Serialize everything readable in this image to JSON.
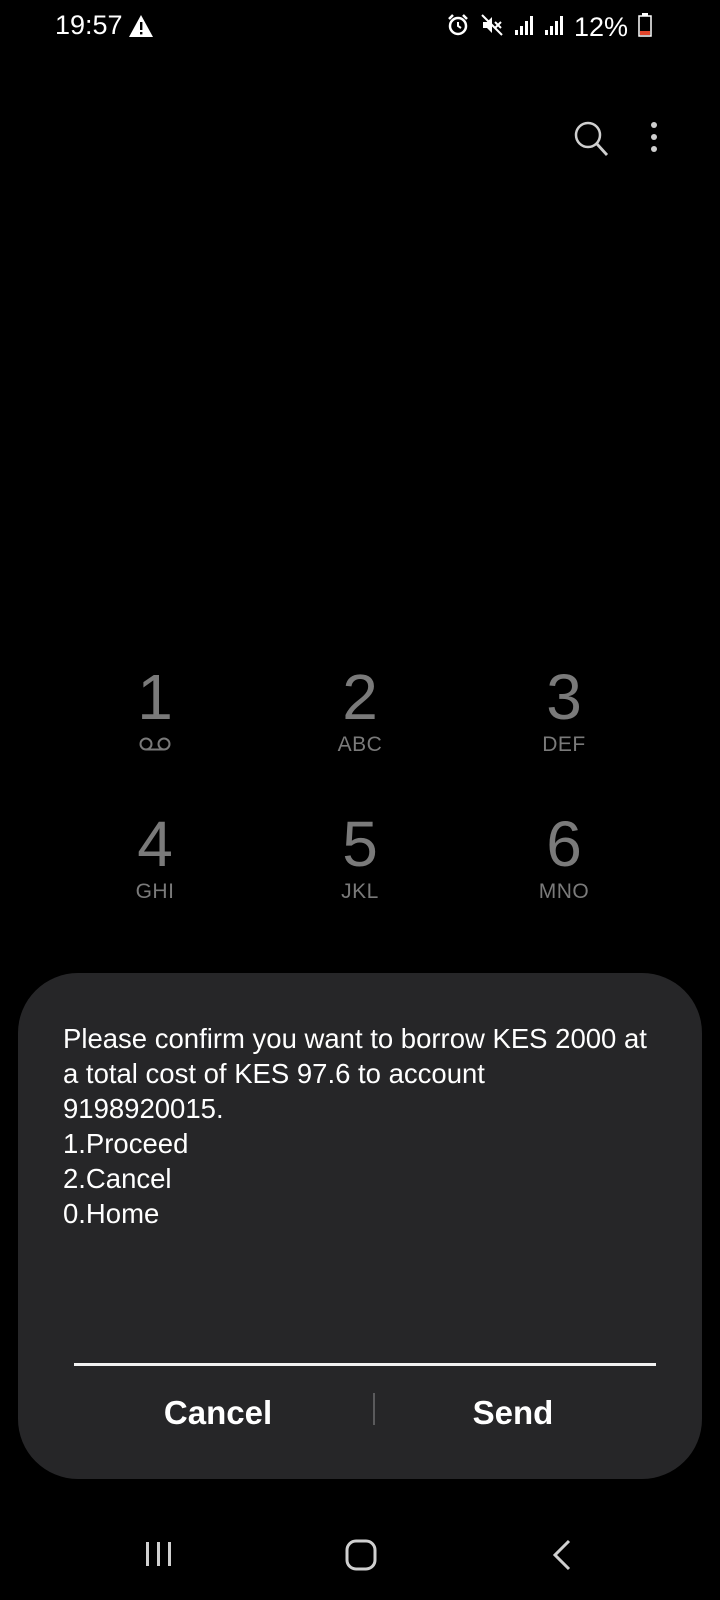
{
  "status_bar": {
    "time": "19:57",
    "battery": "12%",
    "icons": [
      "warning-icon",
      "alarm-icon",
      "mute-icon",
      "signal-icon",
      "signal-icon",
      "battery-icon"
    ]
  },
  "toolbar": {
    "icons": [
      "search-icon",
      "more-options-icon"
    ]
  },
  "keypad": {
    "keys": [
      {
        "digit": "1",
        "letters": ""
      },
      {
        "digit": "2",
        "letters": "ABC"
      },
      {
        "digit": "3",
        "letters": "DEF"
      },
      {
        "digit": "4",
        "letters": "GHI"
      },
      {
        "digit": "5",
        "letters": "JKL"
      },
      {
        "digit": "6",
        "letters": "MNO"
      }
    ]
  },
  "dialog": {
    "message": "Please confirm you want to borrow KES 2000 at a total cost of KES 97.6 to account 9198920015.\n1.Proceed\n2.Cancel\n0.Home",
    "input_value": "",
    "cancel_label": "Cancel",
    "send_label": "Send"
  },
  "colors": {
    "background": "#000000",
    "dialog": "#262628",
    "keypad_text": "#7a7a7a",
    "battery_low": "#e0442b"
  }
}
